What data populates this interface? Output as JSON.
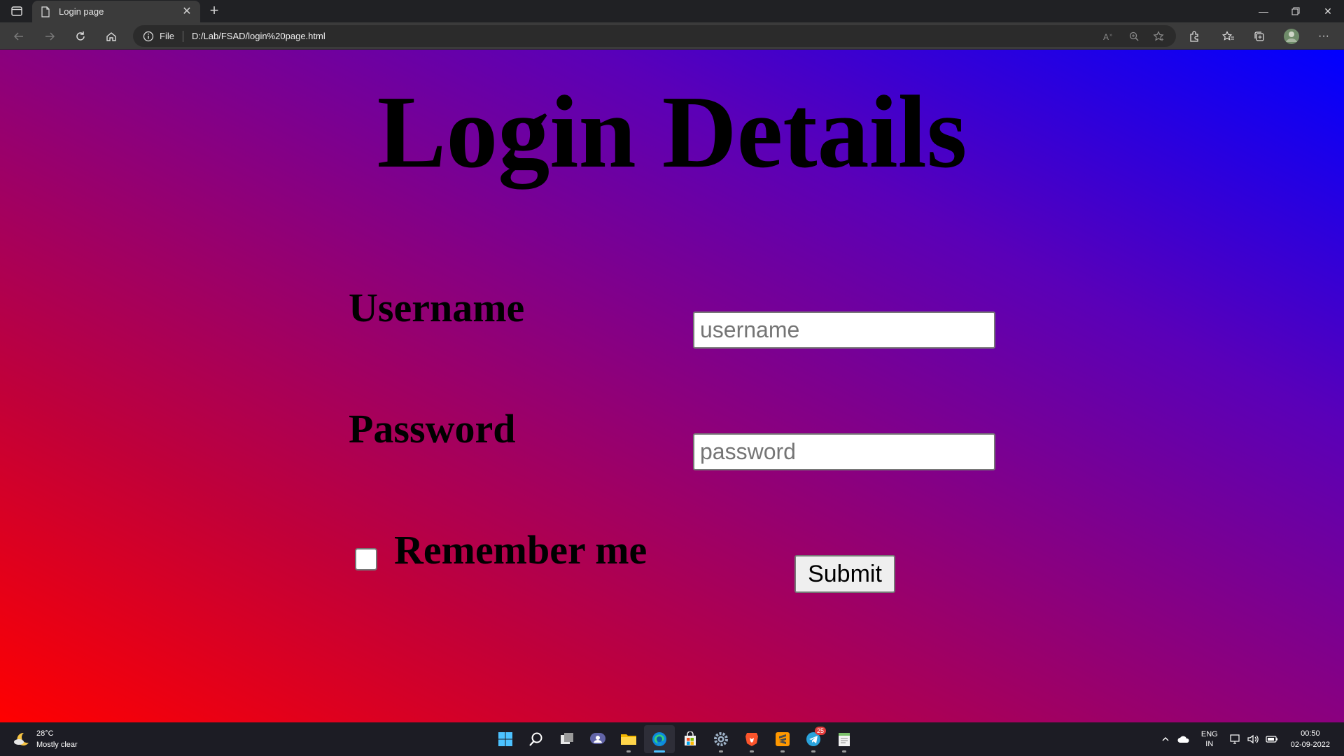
{
  "browser": {
    "tab_title": "Login page",
    "address_scheme_label": "File",
    "url": "D:/Lab/FSAD/login%20page.html"
  },
  "page": {
    "heading": "Login Details",
    "username_label": "Username",
    "username_placeholder": "username",
    "password_label": "Password",
    "password_placeholder": "password",
    "remember_label": "Remember me",
    "remember_checked": false,
    "submit_label": "Submit",
    "gradient_colors": [
      "#ff0000",
      "#0000ff"
    ]
  },
  "taskbar": {
    "weather_temp": "28°C",
    "weather_desc": "Mostly clear",
    "telegram_badge": "25",
    "lang_primary": "ENG",
    "lang_secondary": "IN",
    "time": "00:50",
    "date": "02-09-2022"
  }
}
